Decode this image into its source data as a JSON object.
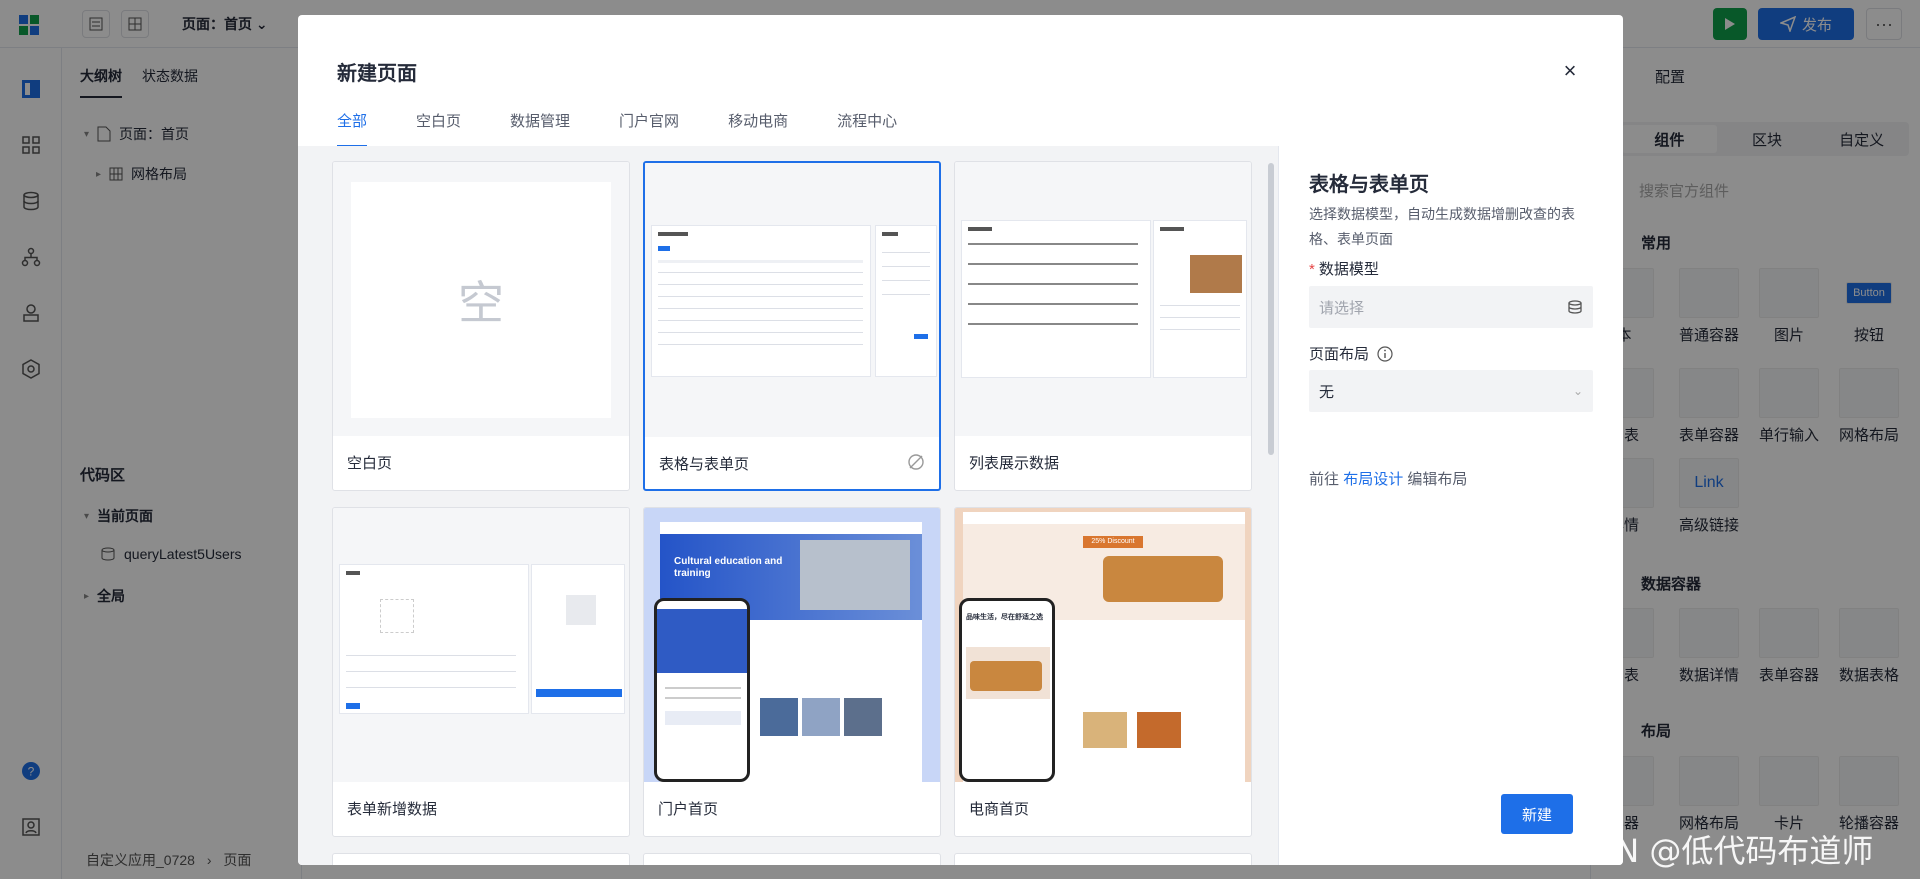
{
  "topbar": {
    "page_select": "页面：首页",
    "publish_label": "发布",
    "more_label": "···"
  },
  "outline": {
    "tabs": [
      "大纲树",
      "状态数据"
    ],
    "tree": {
      "page": "页面：首页",
      "grid": "网格布局"
    },
    "code_section": "代码区",
    "current_page": "当前页面",
    "query": "queryLatest5Users",
    "global": "全局",
    "breadcrumb": [
      "自定义应用_0728",
      "页面"
    ]
  },
  "rpanel": {
    "title": "配置",
    "tabs": [
      "组件",
      "区块",
      "自定义"
    ],
    "search_placeholder": "搜索官方组件",
    "groups": [
      "常用",
      "数据容器",
      "布局"
    ],
    "items_row1": [
      "本",
      "普通容器",
      "图片",
      "按钮"
    ],
    "items_row2": [
      "列表",
      "表单容器",
      "单行输入",
      "网格布局"
    ],
    "items_row3": [
      "详情",
      "高级链接"
    ],
    "items_row4": [
      "列表",
      "数据详情",
      "表单容器",
      "数据表格"
    ],
    "items_row5": [
      "容器",
      "网格布局",
      "卡片",
      "轮播容器"
    ],
    "button_chip": "Button",
    "link_chip": "Link"
  },
  "modal": {
    "title": "新建页面",
    "close": "×",
    "tabs": [
      "全部",
      "空白页",
      "数据管理",
      "门户官网",
      "移动电商",
      "流程中心"
    ],
    "active_tab": "全部",
    "cards": [
      {
        "label": "空白页",
        "thumb_text": "空"
      },
      {
        "label": "表格与表单页"
      },
      {
        "label": "列表展示数据"
      },
      {
        "label": "表单新增数据"
      },
      {
        "label": "门户首页",
        "thumb_text": "Cultural education and training"
      },
      {
        "label": "电商首页",
        "thumb_text": "品味生活，尽在舒适之选",
        "badge": "25% Discount"
      }
    ],
    "side": {
      "title": "表格与表单页",
      "description": "选择数据模型，自动生成数据增删改查的表格、表单页面",
      "model_label": "数据模型",
      "model_placeholder": "请选择",
      "layout_label": "页面布局",
      "layout_value": "无",
      "goto_prefix": "前往",
      "goto_link": "布局设计",
      "goto_suffix": "编辑布局",
      "create_label": "新建"
    }
  },
  "watermark": "CSDN @低代码布道师"
}
